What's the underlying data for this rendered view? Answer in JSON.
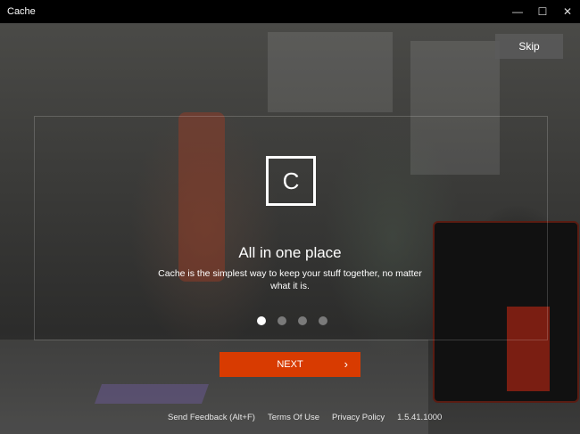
{
  "window": {
    "title": "Cache",
    "minimize_glyph": "—",
    "maximize_glyph": "☐",
    "close_glyph": "✕"
  },
  "skip_label": "Skip",
  "logo_letter": "C",
  "slide": {
    "heading": "All in one place",
    "description": "Cache is the simplest way to keep your stuff together, no matter what it is.",
    "current_index": 1,
    "total": 4
  },
  "next_label": "NEXT",
  "next_chevron": "›",
  "footer": {
    "feedback": "Send Feedback (Alt+F)",
    "terms": "Terms Of Use",
    "privacy": "Privacy Policy",
    "version": "1.5.41.1000"
  },
  "colors": {
    "accent": "#d83b01",
    "titlebar": "#000000"
  }
}
